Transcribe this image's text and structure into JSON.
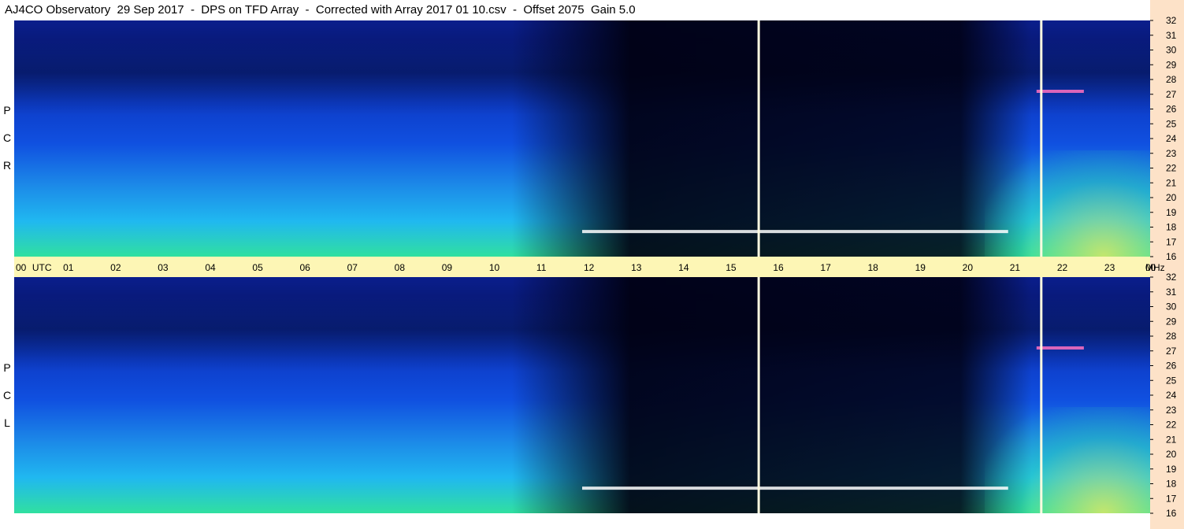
{
  "title": "AJ4CO Observatory  29 Sep 2017  -  DPS on TFD Array  -  Corrected with Array 2017 01 10.csv  -  Offset 2075  Gain 5.0",
  "colors": {
    "dark": "#000010",
    "navy": "#0a1e8c",
    "blue": "#1050e0",
    "cyan": "#20b8f0",
    "green": "#30e0a0",
    "yellow": "#e8e860",
    "band": "#fdf6b5",
    "strip": "#fde2c8"
  },
  "chart_data": {
    "type": "heatmap",
    "panels": [
      {
        "name": "R C P",
        "letters": [
          "R",
          "C",
          "P"
        ]
      },
      {
        "name": "L C P",
        "letters": [
          "L",
          "C",
          "P"
        ]
      }
    ],
    "x_ticks": [
      "00",
      "UTC",
      "01",
      "02",
      "03",
      "04",
      "05",
      "06",
      "07",
      "08",
      "09",
      "10",
      "11",
      "12",
      "13",
      "14",
      "15",
      "16",
      "17",
      "18",
      "19",
      "20",
      "21",
      "22",
      "23",
      "00"
    ],
    "x_hours": [
      0,
      1,
      2,
      3,
      4,
      5,
      6,
      7,
      8,
      9,
      10,
      11,
      12,
      13,
      14,
      15,
      16,
      17,
      18,
      19,
      20,
      21,
      22,
      23,
      24
    ],
    "x_unit": "UTC",
    "y_ticks": [
      "32",
      "31",
      "30",
      "29",
      "28",
      "27",
      "26",
      "25",
      "24",
      "23",
      "22",
      "21",
      "20",
      "19",
      "18",
      "17",
      "16"
    ],
    "y_unit": "MHz",
    "ylim": [
      16,
      32
    ],
    "xlim": [
      0,
      24
    ],
    "markers_utc": [
      15.73,
      21.7
    ],
    "dark_region_utc": [
      10.5,
      21.5
    ],
    "bright_bursts_mhz": [
      17.7,
      27.2
    ]
  }
}
